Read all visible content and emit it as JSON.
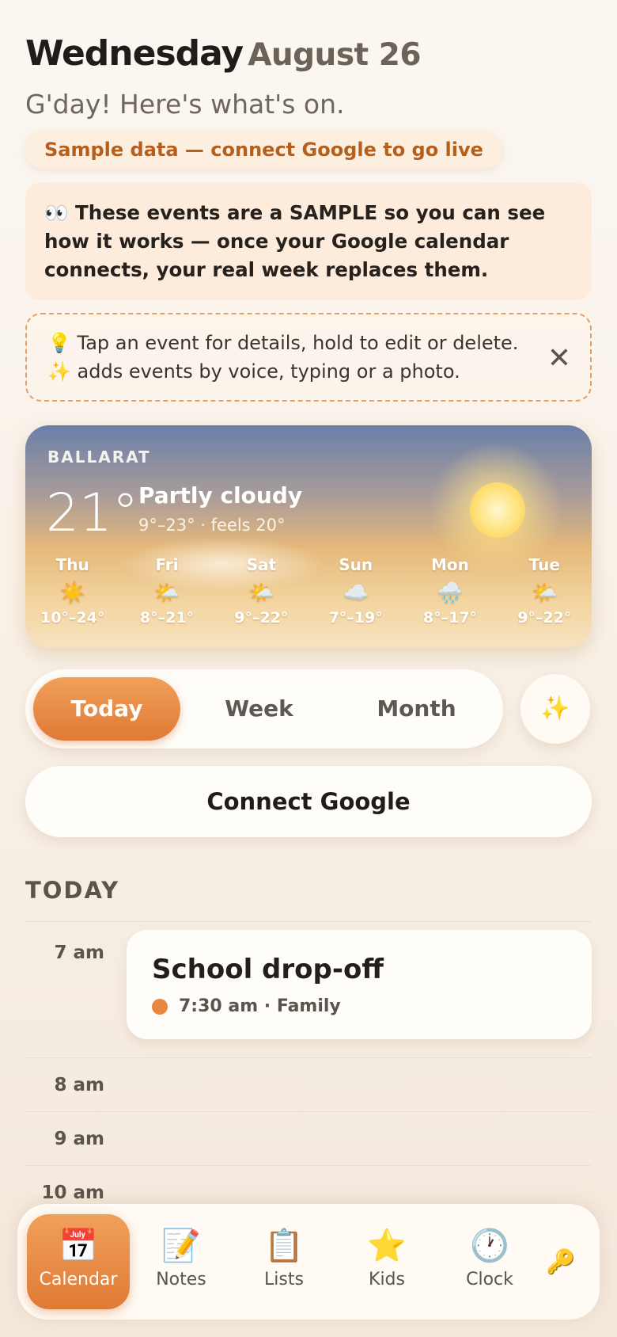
{
  "header": {
    "day": "Wednesday",
    "date": "August 26",
    "greeting": "G'day! Here's what's on.",
    "sample_pill": "Sample data — connect Google to go live"
  },
  "notice": {
    "icon": "👀",
    "text": "These events are a SAMPLE so you can see how it works — once your Google calendar connects, your real week replaces them."
  },
  "tip": {
    "line1_icon": "💡",
    "line1": "Tap an event for details, hold to edit or delete.",
    "line2_icon": "✨",
    "line2": "adds events by voice, typing or a photo.",
    "close": "✕"
  },
  "weather": {
    "city": "BALLARAT",
    "temp": "21°",
    "condition": "Partly cloudy",
    "range": "9°–23° · feels 20°",
    "forecast": [
      {
        "day": "Thu",
        "icon": "☀️",
        "range": "10°–24°"
      },
      {
        "day": "Fri",
        "icon": "🌤️",
        "range": "8°–21°"
      },
      {
        "day": "Sat",
        "icon": "🌤️",
        "range": "9°–22°"
      },
      {
        "day": "Sun",
        "icon": "☁️",
        "range": "7°–19°"
      },
      {
        "day": "Mon",
        "icon": "🌧️",
        "range": "8°–17°"
      },
      {
        "day": "Tue",
        "icon": "🌤️",
        "range": "9°–22°"
      }
    ]
  },
  "view_switch": {
    "options": [
      "Today",
      "Week",
      "Month"
    ],
    "active": "Today",
    "magic_icon": "✨"
  },
  "connect_button": "Connect Google",
  "today": {
    "section_title": "TODAY",
    "hours": [
      "7 am",
      "8 am",
      "9 am",
      "10 am"
    ],
    "event": {
      "title": "School drop-off",
      "meta": "7:30 am · Family",
      "color": "#e8883e"
    }
  },
  "nav": {
    "items": [
      {
        "label": "Calendar",
        "icon": "📅"
      },
      {
        "label": "Notes",
        "icon": "📝"
      },
      {
        "label": "Lists",
        "icon": "📋"
      },
      {
        "label": "Kids",
        "icon": "⭐"
      },
      {
        "label": "Clock",
        "icon": "🕐"
      }
    ],
    "active": "Calendar",
    "key_icon": "🔑"
  }
}
